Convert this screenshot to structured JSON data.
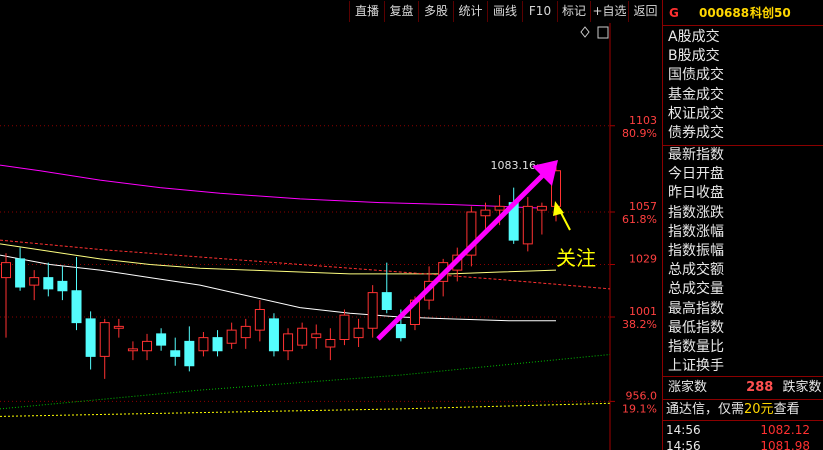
{
  "toolbar": {
    "buttons": [
      "直播",
      "复盘",
      "多股",
      "统计",
      "画线",
      "F10",
      "标记",
      "+自选",
      "返回"
    ]
  },
  "chart": {
    "axis_labels": [
      {
        "price": "1103",
        "pct": "80.9%"
      },
      {
        "price": "1057",
        "pct": "61.8%"
      },
      {
        "price": "1029",
        "pct": ""
      },
      {
        "price": "1001",
        "pct": "38.2%"
      },
      {
        "price": "956.0",
        "pct": "19.1%"
      }
    ],
    "high_label": "1083.16",
    "annotation": "关注",
    "colors": {
      "up": "#ff3232",
      "down": "#54fcfc",
      "ma_magenta": "#ff00ff",
      "ma_white": "#ffffff",
      "ma_yellow": "#ffff80",
      "arrow": "#ff00ff",
      "annotation": "#ffff00"
    }
  },
  "right_panel": {
    "market_indicator": "G",
    "code": "000688",
    "name": "科创50",
    "trade_types": [
      "A股成交",
      "B股成交",
      "国债成交",
      "基金成交",
      "权证成交",
      "债券成交"
    ],
    "index_fields": [
      "最新指数",
      "今日开盘",
      "昨日收盘",
      "指数涨跌",
      "指数涨幅",
      "指数振幅",
      "总成交额",
      "总成交量",
      "最高指数",
      "最低指数",
      "指数量比",
      "上证换手"
    ],
    "up_label": "涨家数",
    "up_count": "288",
    "down_label": "跌家数",
    "promo_prefix": "通达信，仅需",
    "promo_highlight": "20元",
    "promo_suffix": "查看",
    "ticks": [
      {
        "time": "14:56",
        "price": "1082.12"
      },
      {
        "time": "14:56",
        "price": "1081.98"
      }
    ]
  },
  "chart_data": {
    "type": "candlestick",
    "axis_ticks": [
      956.0,
      1001,
      1029,
      1057,
      1103
    ],
    "y_axis_pct": [
      "19.1%",
      "38.2%",
      "61.8%",
      "80.9%"
    ],
    "high_label": 1083.16,
    "candles": [
      {
        "o": 1022,
        "h": 1035,
        "l": 990,
        "c": 1030
      },
      {
        "o": 1032,
        "h": 1038,
        "l": 1015,
        "c": 1017
      },
      {
        "o": 1018,
        "h": 1026,
        "l": 1010,
        "c": 1022
      },
      {
        "o": 1022,
        "h": 1030,
        "l": 1012,
        "c": 1016
      },
      {
        "o": 1020,
        "h": 1028,
        "l": 1010,
        "c": 1015
      },
      {
        "o": 1015,
        "h": 1033,
        "l": 994,
        "c": 998
      },
      {
        "o": 1000,
        "h": 1004,
        "l": 973,
        "c": 980
      },
      {
        "o": 980,
        "h": 1000,
        "l": 968,
        "c": 998
      },
      {
        "o": 995,
        "h": 1000,
        "l": 990,
        "c": 996
      },
      {
        "o": 983,
        "h": 988,
        "l": 978,
        "c": 984
      },
      {
        "o": 983,
        "h": 992,
        "l": 978,
        "c": 988
      },
      {
        "o": 992,
        "h": 995,
        "l": 983,
        "c": 986
      },
      {
        "o": 983,
        "h": 990,
        "l": 975,
        "c": 980
      },
      {
        "o": 988,
        "h": 996,
        "l": 972,
        "c": 975
      },
      {
        "o": 983,
        "h": 993,
        "l": 980,
        "c": 990
      },
      {
        "o": 990,
        "h": 994,
        "l": 980,
        "c": 983
      },
      {
        "o": 987,
        "h": 998,
        "l": 984,
        "c": 994
      },
      {
        "o": 990,
        "h": 1000,
        "l": 984,
        "c": 996
      },
      {
        "o": 994,
        "h": 1010,
        "l": 988,
        "c": 1005
      },
      {
        "o": 1000,
        "h": 1003,
        "l": 980,
        "c": 983
      },
      {
        "o": 983,
        "h": 995,
        "l": 978,
        "c": 992
      },
      {
        "o": 986,
        "h": 998,
        "l": 984,
        "c": 995
      },
      {
        "o": 990,
        "h": 997,
        "l": 984,
        "c": 992
      },
      {
        "o": 985,
        "h": 995,
        "l": 978,
        "c": 989
      },
      {
        "o": 989,
        "h": 1005,
        "l": 986,
        "c": 1002
      },
      {
        "o": 990,
        "h": 1000,
        "l": 985,
        "c": 995
      },
      {
        "o": 995,
        "h": 1018,
        "l": 990,
        "c": 1014
      },
      {
        "o": 1014,
        "h": 1030,
        "l": 1003,
        "c": 1005
      },
      {
        "o": 997,
        "h": 1005,
        "l": 988,
        "c": 990
      },
      {
        "o": 997,
        "h": 1012,
        "l": 994,
        "c": 1010
      },
      {
        "o": 1010,
        "h": 1028,
        "l": 1005,
        "c": 1020
      },
      {
        "o": 1020,
        "h": 1032,
        "l": 1012,
        "c": 1030
      },
      {
        "o": 1026,
        "h": 1038,
        "l": 1020,
        "c": 1034
      },
      {
        "o": 1034,
        "h": 1060,
        "l": 1028,
        "c": 1057
      },
      {
        "o": 1055,
        "h": 1062,
        "l": 1048,
        "c": 1058
      },
      {
        "o": 1058,
        "h": 1066,
        "l": 1050,
        "c": 1060
      },
      {
        "o": 1062,
        "h": 1070,
        "l": 1040,
        "c": 1042
      },
      {
        "o": 1040,
        "h": 1065,
        "l": 1036,
        "c": 1060
      },
      {
        "o": 1058,
        "h": 1062,
        "l": 1045,
        "c": 1060
      },
      {
        "o": 1060,
        "h": 1083.16,
        "l": 1052,
        "c": 1079
      }
    ],
    "ma_lines": [
      {
        "name": "magenta",
        "points": [
          [
            0,
            1082
          ],
          [
            40,
            1079
          ],
          [
            100,
            1074
          ],
          [
            160,
            1070
          ],
          [
            220,
            1067
          ],
          [
            300,
            1064
          ],
          [
            380,
            1062
          ],
          [
            450,
            1061
          ],
          [
            500,
            1060
          ],
          [
            545,
            1059
          ]
        ]
      },
      {
        "name": "white",
        "points": [
          [
            0,
            1034
          ],
          [
            50,
            1029
          ],
          [
            100,
            1026
          ],
          [
            150,
            1022
          ],
          [
            200,
            1018
          ],
          [
            250,
            1012
          ],
          [
            300,
            1006
          ],
          [
            350,
            1003
          ],
          [
            400,
            1001
          ],
          [
            450,
            1000
          ],
          [
            510,
            999
          ],
          [
            556,
            999
          ]
        ]
      },
      {
        "name": "yellow",
        "points": [
          [
            0,
            1040
          ],
          [
            50,
            1036
          ],
          [
            100,
            1032
          ],
          [
            150,
            1029
          ],
          [
            200,
            1027
          ],
          [
            250,
            1026
          ],
          [
            300,
            1025
          ],
          [
            350,
            1024
          ],
          [
            400,
            1024
          ],
          [
            450,
            1024
          ],
          [
            500,
            1025
          ],
          [
            556,
            1026
          ]
        ]
      },
      {
        "name": "red-dash",
        "points": [
          [
            0,
            1042
          ],
          [
            100,
            1037
          ],
          [
            200,
            1033
          ],
          [
            300,
            1029
          ],
          [
            400,
            1025
          ],
          [
            500,
            1021
          ],
          [
            610,
            1016
          ]
        ]
      },
      {
        "name": "green-dot",
        "points": [
          [
            0,
            952
          ],
          [
            200,
            962
          ],
          [
            400,
            970
          ],
          [
            610,
            981
          ]
        ]
      },
      {
        "name": "yellow-dash",
        "points": [
          [
            0,
            948
          ],
          [
            200,
            950
          ],
          [
            400,
            952
          ],
          [
            610,
            955
          ]
        ]
      }
    ]
  }
}
